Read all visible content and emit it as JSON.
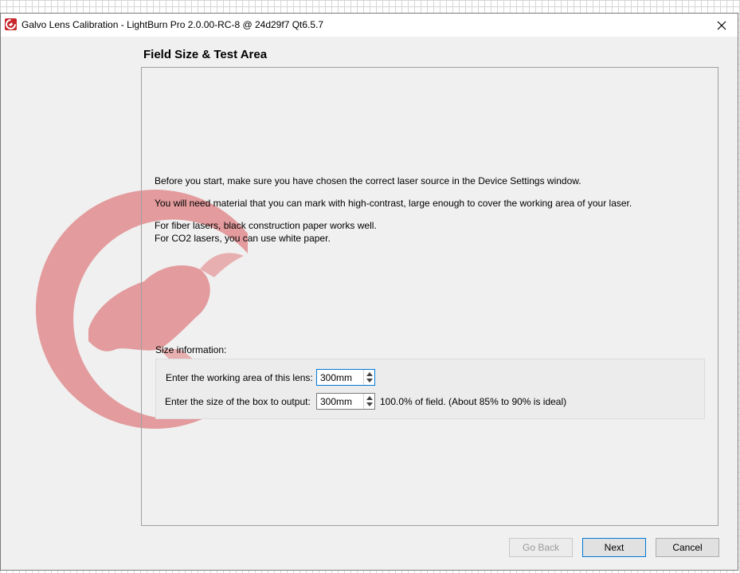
{
  "window": {
    "title": "Galvo Lens Calibration - LightBurn Pro 2.0.00-RC-8 @ 24d29f7 Qt6.5.7",
    "icon": "lightburn-logo-icon",
    "close_icon": "close-icon"
  },
  "page": {
    "title": "Field Size & Test Area",
    "paragraphs": {
      "p1": "Before you start, make sure you have chosen the correct laser source in the Device Settings window.",
      "p2": "You will need material that you can mark with high-contrast, large enough to cover the working area of your laser.",
      "p3a": "For fiber lasers, black construction paper works well.",
      "p3b": "For CO2 lasers, you can use white paper."
    }
  },
  "size_info": {
    "label": "Size information:",
    "working_area": {
      "label": "Enter the working area of this lens:",
      "value": "300mm"
    },
    "box_size": {
      "label": "Enter the size of the box to output:",
      "value": "300mm",
      "note": "100.0% of field.  (About 85% to 90% is ideal)"
    }
  },
  "buttons": {
    "back": "Go Back",
    "next": "Next",
    "cancel": "Cancel"
  },
  "colors": {
    "accent": "#0078d7",
    "brand": "#c8262b"
  }
}
